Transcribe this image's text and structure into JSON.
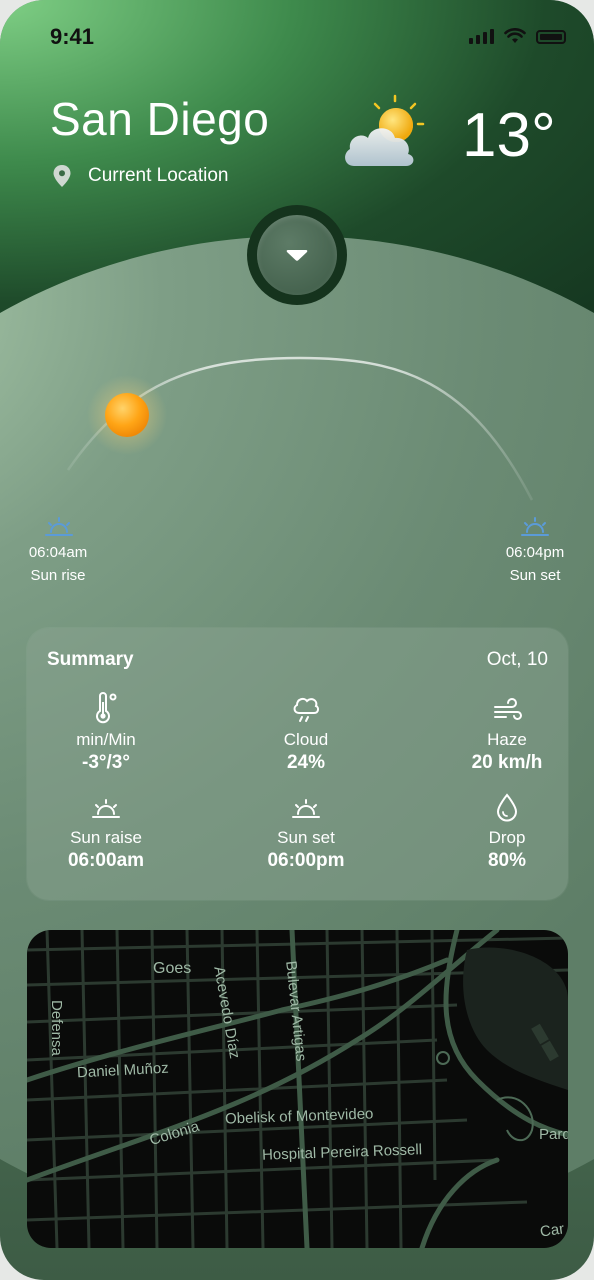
{
  "status": {
    "time": "9:41"
  },
  "header": {
    "city": "San Diego",
    "location_label": "Current Location",
    "temperature": "13°",
    "weather_icon": "partly-cloudy-icon"
  },
  "sun": {
    "sunrise_time": "06:04am",
    "sunrise_label": "Sun rise",
    "sunset_time": "06:04pm",
    "sunset_label": "Sun set"
  },
  "summary": {
    "title": "Summary",
    "date": "Oct, 10",
    "items": [
      {
        "icon": "thermometer-icon",
        "label": "min/Min",
        "value": "-3°/3°"
      },
      {
        "icon": "cloud-rain-icon",
        "label": "Cloud",
        "value": "24%"
      },
      {
        "icon": "wind-icon",
        "label": "Haze",
        "value": "20 km/h"
      },
      {
        "icon": "sunrise-icon",
        "label": "Sun raise",
        "value": "06:00am"
      },
      {
        "icon": "sunset-icon",
        "label": "Sun set",
        "value": "06:00pm"
      },
      {
        "icon": "drop-icon",
        "label": "Drop",
        "value": "80%"
      }
    ]
  },
  "map": {
    "labels": [
      "Goes",
      "Defensa",
      "Acevedo Díaz",
      "Bulevar Artigas",
      "Daniel Muñoz",
      "Colonia",
      "Obelisk of Montevideo",
      "Hospital Pereira Rossell",
      "Parq",
      "Car"
    ]
  }
}
